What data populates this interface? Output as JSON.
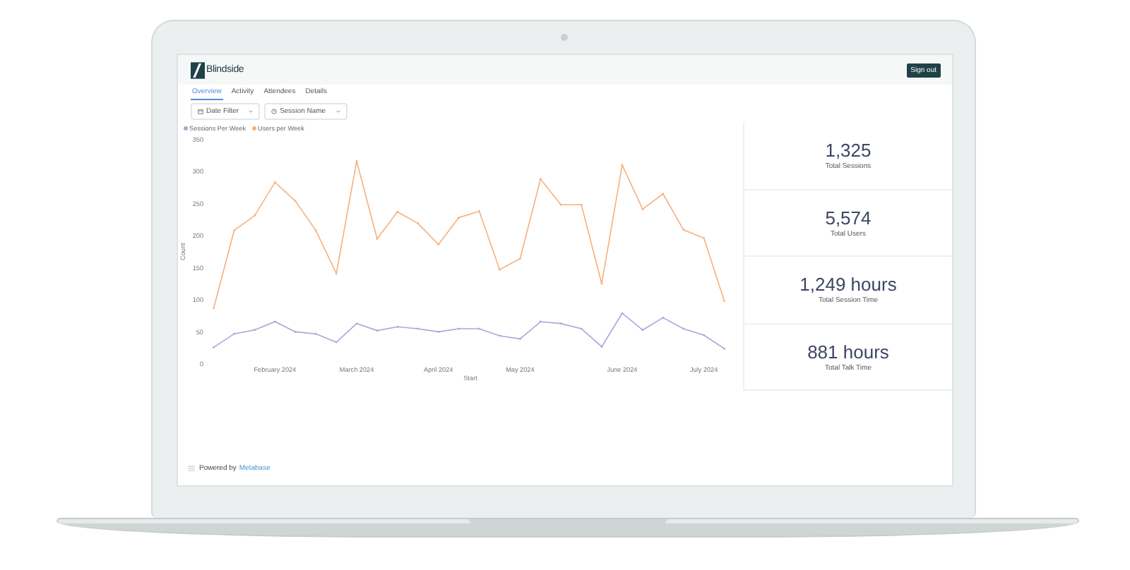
{
  "logo": {
    "text": "Blindside"
  },
  "header": {
    "sign_out": "Sign out"
  },
  "tabs": [
    {
      "label": "Overview",
      "selected": true
    },
    {
      "label": "Activity",
      "selected": false
    },
    {
      "label": "Attendees",
      "selected": false
    },
    {
      "label": "Details",
      "selected": false
    }
  ],
  "filters": [
    {
      "kind": "date",
      "label": "Date Filter"
    },
    {
      "kind": "session",
      "label": "Session Name"
    }
  ],
  "chart": {
    "chart_data": {
      "type": "line",
      "xlabel": "Start",
      "ylabel": "Count",
      "categories": [
        null,
        null,
        null,
        "February 2024",
        null,
        null,
        null,
        "March 2024",
        null,
        null,
        null,
        "April 2024",
        null,
        null,
        null,
        "May 2024",
        null,
        null,
        null,
        null,
        "June 2024",
        null,
        null,
        null,
        "July 2024",
        null
      ],
      "legend": "top-left",
      "ylim": [
        0,
        350
      ],
      "yticks": [
        0,
        50,
        100,
        150,
        200,
        250,
        300,
        350
      ],
      "series": [
        {
          "name": "Sessions Per Week",
          "color": "#a9a6d8",
          "values": [
            26,
            47,
            53,
            66,
            50,
            47,
            34,
            63,
            52,
            58,
            55,
            50,
            55,
            55,
            44,
            39,
            66,
            63,
            55,
            27,
            79,
            53,
            72,
            55,
            45,
            24
          ]
        },
        {
          "name": "Users per Week",
          "color": "#f6b07c",
          "values": [
            87,
            208,
            231,
            283,
            254,
            208,
            141,
            316,
            195,
            237,
            219,
            186,
            228,
            238,
            147,
            164,
            288,
            248,
            248,
            125,
            310,
            241,
            265,
            209,
            196,
            98
          ]
        }
      ]
    }
  },
  "stats": [
    {
      "value": "1,325",
      "label": "Total Sessions"
    },
    {
      "value": "5,574",
      "label": "Total Users"
    },
    {
      "value": "1,249 hours",
      "label": "Total Session Time"
    },
    {
      "value": "881 hours",
      "label": "Total Talk Time"
    }
  ],
  "footer": {
    "prefix": "Powered by",
    "link": "Metabase"
  }
}
